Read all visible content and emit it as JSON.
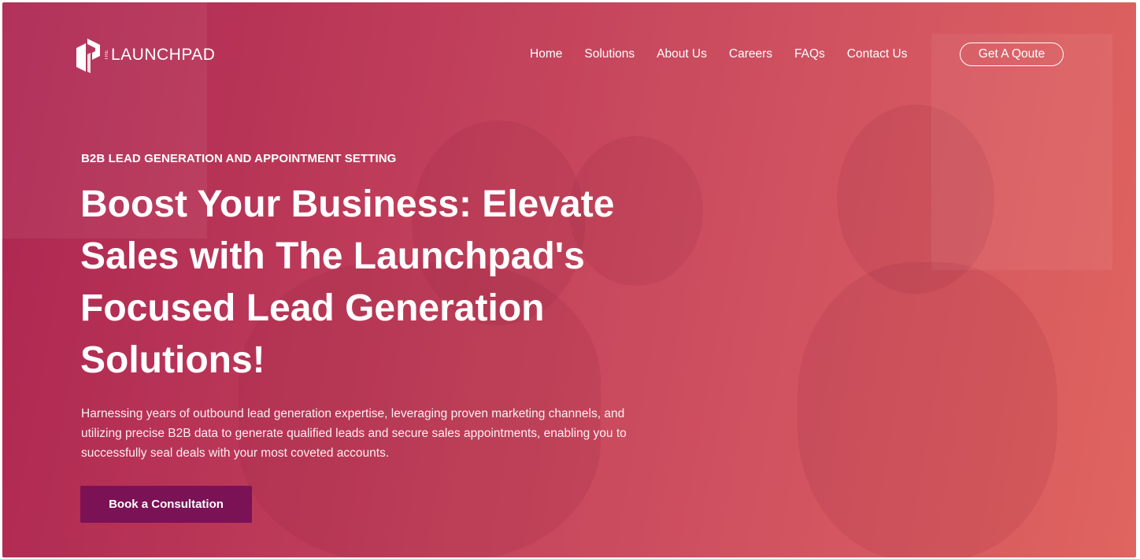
{
  "brand": {
    "logo_small_text": "THE",
    "logo_text": "LAUNCHPAD",
    "logo_icon": "launchpad-logo-icon"
  },
  "nav": {
    "items": [
      {
        "label": "Home"
      },
      {
        "label": "Solutions"
      },
      {
        "label": "About Us"
      },
      {
        "label": "Careers"
      },
      {
        "label": "FAQs"
      },
      {
        "label": "Contact Us"
      }
    ],
    "cta_label": "Get A Qoute"
  },
  "hero": {
    "eyebrow": "B2B LEAD GENERATION AND APPOINTMENT SETTING",
    "headline_lines": [
      "Boost Your Business: Elevate",
      "Sales with The Launchpad's",
      "Focused Lead Generation",
      "Solutions!"
    ],
    "description_lines": [
      "Harnessing years of outbound lead generation expertise, leveraging proven marketing channels, and",
      "utilizing precise B2B data to generate qualified leads and secure sales appointments, enabling you to",
      "successfully seal deals with your most coveted accounts."
    ],
    "cta_label": "Book a Consultation"
  },
  "colors": {
    "overlay_start": "#ad2651",
    "overlay_end": "#e0645f",
    "cta_background": "#7a1255",
    "text": "#ffffff"
  }
}
